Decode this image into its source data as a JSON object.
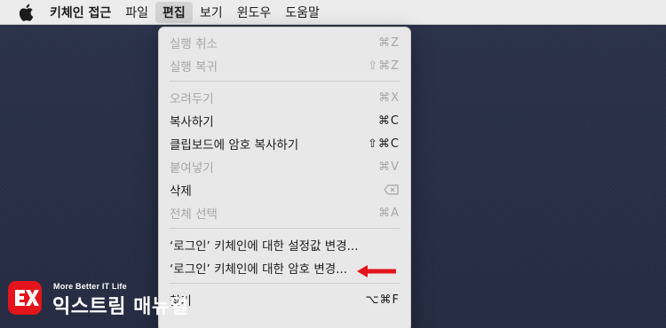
{
  "menubar": {
    "apple_icon": "apple-icon",
    "app_name": "키체인 접근",
    "items": [
      {
        "label": "파일"
      },
      {
        "label": "편집"
      },
      {
        "label": "보기"
      },
      {
        "label": "윈도우"
      },
      {
        "label": "도움말"
      }
    ],
    "active_item": "편집"
  },
  "edit_menu": {
    "items": [
      {
        "label": "실행 취소",
        "shortcut": "⌘Z",
        "enabled": false
      },
      {
        "label": "실행 복귀",
        "shortcut": "⇧⌘Z",
        "enabled": false
      },
      {
        "label": "오려두기",
        "shortcut": "⌘X",
        "enabled": false
      },
      {
        "label": "복사하기",
        "shortcut": "⌘C",
        "enabled": true
      },
      {
        "label": "클립보드에 암호 복사하기",
        "shortcut": "⇧⌘C",
        "enabled": true
      },
      {
        "label": "붙여넣기",
        "shortcut": "⌘V",
        "enabled": false
      },
      {
        "label": "삭제",
        "shortcut": "delete-icon",
        "enabled": true
      },
      {
        "label": "전체 선택",
        "shortcut": "⌘A",
        "enabled": false
      },
      {
        "label": "‘로그인’ 키체인에 대한 설정값 변경...",
        "shortcut": "",
        "enabled": true
      },
      {
        "label": "‘로그인’ 키체인에 대한 암호 변경...",
        "shortcut": "",
        "enabled": true
      },
      {
        "label": "찾기",
        "shortcut": "⌥⌘F",
        "enabled": true
      }
    ]
  },
  "annotation": {
    "arrow_color": "#e3141b"
  },
  "brand": {
    "logo_color": "#e3141b",
    "subtitle": "More Better IT Life",
    "title": "익스트림 매뉴얼"
  }
}
